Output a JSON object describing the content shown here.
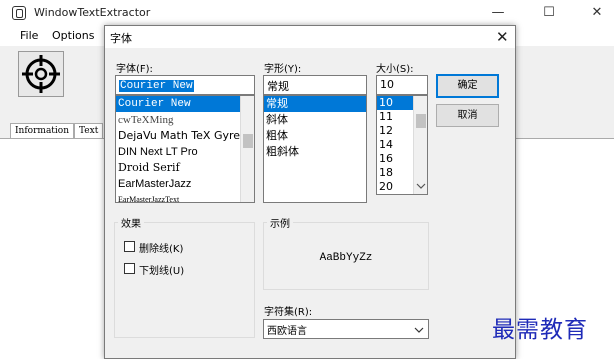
{
  "app": {
    "title": "WindowTextExtractor",
    "menu": [
      "File",
      "Options"
    ],
    "tabs": [
      "Information",
      "Text"
    ],
    "controls": {
      "minimize": "—",
      "maximize": "☐",
      "close": "✕"
    }
  },
  "dialog": {
    "title": "字体",
    "close": "✕",
    "font_label": "字体(F):",
    "font_value": "Courier New",
    "font_list": [
      "Courier New",
      "cwTeXMing",
      "DejaVu Math TeX Gyre",
      "DIN Next LT Pro",
      "Droid Serif",
      "EarMasterJazz",
      "EarMasterJazzText"
    ],
    "font_selected": "Courier New",
    "style_label": "字形(Y):",
    "style_value": "常规",
    "style_list": [
      "常规",
      "斜体",
      "粗体",
      "粗斜体"
    ],
    "style_selected": "常规",
    "size_label": "大小(S):",
    "size_value": "10",
    "size_list": [
      "10",
      "11",
      "12",
      "14",
      "16",
      "18",
      "20"
    ],
    "size_selected": "10",
    "ok_label": "确定",
    "cancel_label": "取消",
    "effects_label": "效果",
    "strikeout_label": "删除线(K)",
    "underline_label": "下划线(U)",
    "sample_label": "示例",
    "sample_text": "AaBbYyZz",
    "charset_label": "字符集(R):",
    "charset_value": "西欧语言"
  },
  "watermark": "最需教育",
  "icons": {
    "target": "crosshair-icon",
    "dropdown": "chevron-down-icon"
  }
}
